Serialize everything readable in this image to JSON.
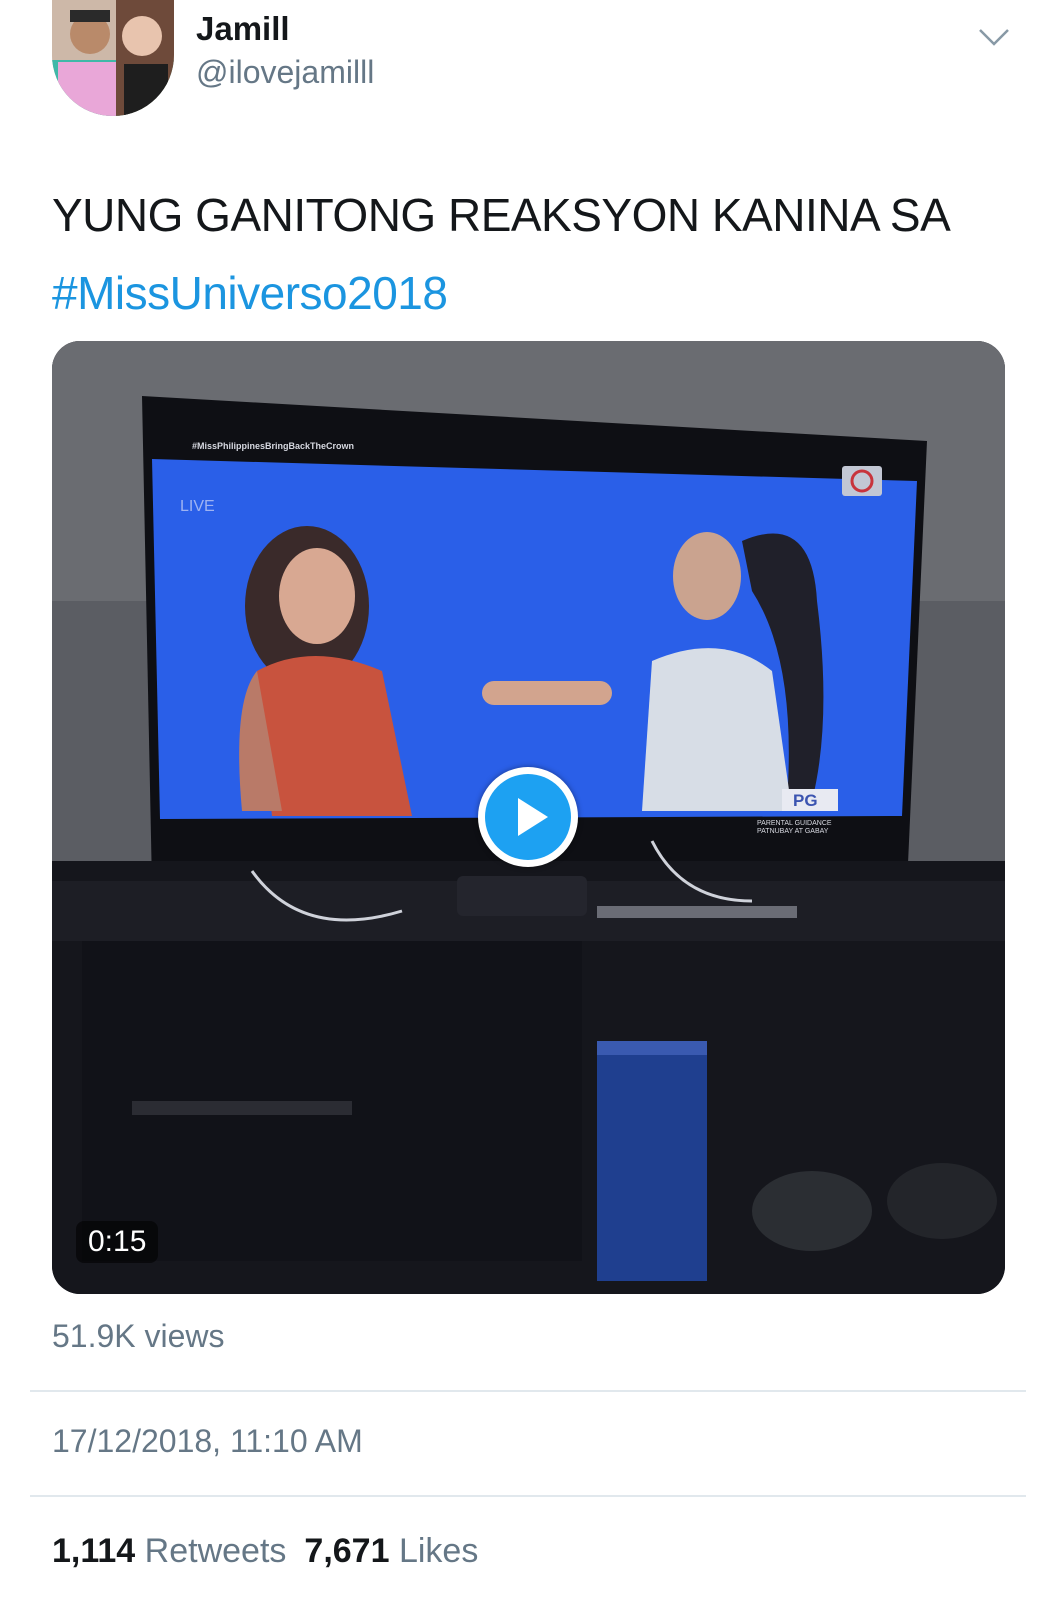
{
  "user": {
    "display_name": "Jamill",
    "handle": "@ilovejamilll"
  },
  "tweet": {
    "text": "YUNG GANITONG REAKSYON KANINA SA",
    "hashtag": "#MissUniverso2018"
  },
  "media": {
    "duration": "0:15",
    "overlay_hashtag": "#MissPhilippinesBringBackTheCrown",
    "live_label": "LIVE",
    "rating": "PG",
    "rating_caption_1": "PARENTAL GUIDANCE",
    "rating_caption_2": "PATNUBAY AT GABAY"
  },
  "views": "51.9K views",
  "timestamp": "17/12/2018, 11:10 AM",
  "stats": {
    "retweets_count": "1,114",
    "retweets_label": "Retweets",
    "likes_count": "7,671",
    "likes_label": "Likes"
  },
  "colors": {
    "accent": "#1da1f2",
    "hashtag": "#1b95e0",
    "secondary_text": "#657786",
    "divider": "#e1e8ed"
  },
  "icons": {
    "more": "chevron-down-icon",
    "play": "play-icon"
  }
}
